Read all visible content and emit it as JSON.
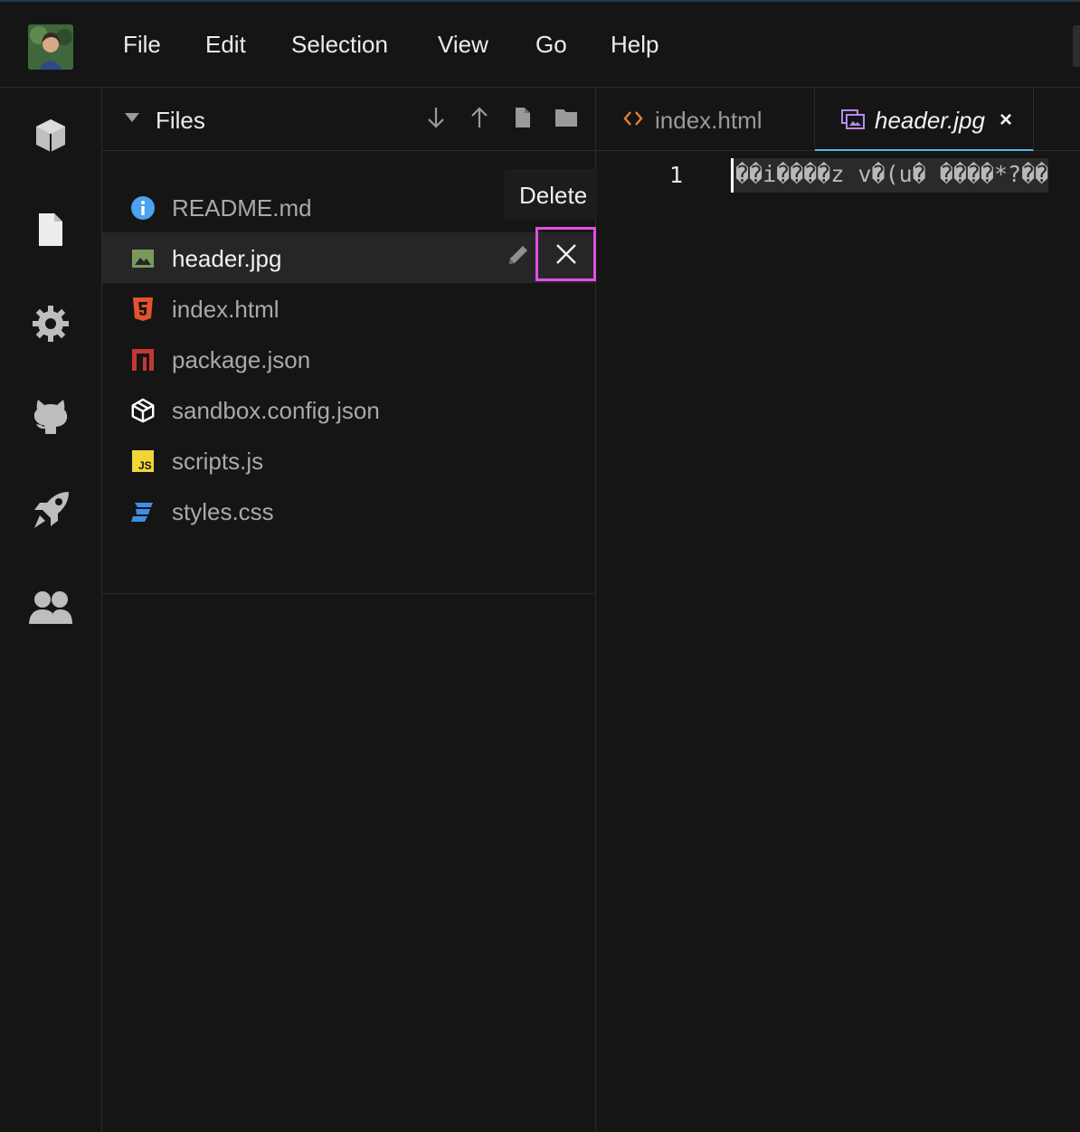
{
  "menubar": {
    "items": [
      "File",
      "Edit",
      "Selection",
      "View",
      "Go",
      "Help"
    ]
  },
  "activity_bar": {
    "icons": [
      "cube-icon",
      "file-icon",
      "gear-icon",
      "github-icon",
      "rocket-icon",
      "users-icon"
    ]
  },
  "sidebar": {
    "title": "Files",
    "files": [
      {
        "name": "README.md",
        "icon": "info-icon",
        "color": "#4aa3ef"
      },
      {
        "name": "header.jpg",
        "icon": "image-icon",
        "color": "#7a9a5b",
        "active": true
      },
      {
        "name": "index.html",
        "icon": "html5-icon",
        "color": "#e5532d"
      },
      {
        "name": "package.json",
        "icon": "npm-icon",
        "color": "#c53635"
      },
      {
        "name": "sandbox.config.json",
        "icon": "codesandbox-icon",
        "color": "#ffffff"
      },
      {
        "name": "scripts.js",
        "icon": "js-icon",
        "color": "#f0d43a"
      },
      {
        "name": "styles.css",
        "icon": "css3-icon",
        "color": "#3f8fe4"
      }
    ],
    "tooltip": "Delete"
  },
  "editor": {
    "tabs": [
      {
        "label": "index.html",
        "icon": "code-icon"
      },
      {
        "label": "header.jpg",
        "icon": "image-tab-icon",
        "active": true,
        "close": "×"
      }
    ],
    "line_number": "1",
    "code": "��i����z v�(u� ����*?��"
  },
  "colors": {
    "annotation": "#e24fe4",
    "active_tab_underline": "#5ab4e8"
  }
}
